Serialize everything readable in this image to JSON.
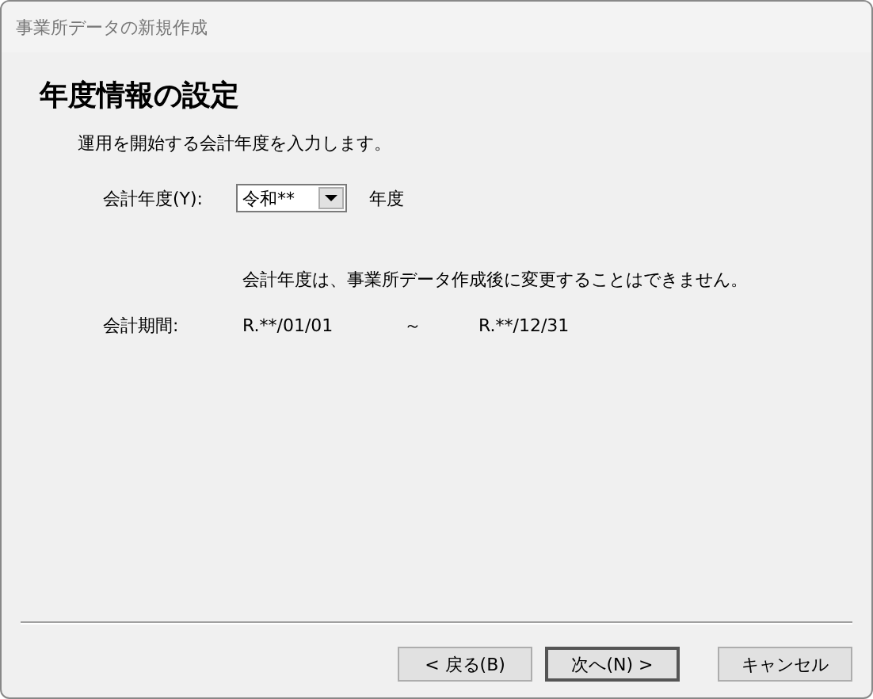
{
  "window": {
    "title": "事業所データの新規作成"
  },
  "heading": "年度情報の設定",
  "instruction": "運用を開始する会計年度を入力します。",
  "fiscal_year": {
    "label": "会計年度(Y):",
    "value": "令和**",
    "suffix": "年度"
  },
  "note": "会計年度は、事業所データ作成後に変更することはできません。",
  "period": {
    "label": "会計期間:",
    "start": "R.**/01/01",
    "separator": "～",
    "end": "R.**/12/31"
  },
  "buttons": [
    {
      "label": "< 戻る(B)",
      "default": false
    },
    {
      "label": "次へ(N) >",
      "default": true
    },
    {
      "label": "キャンセル",
      "default": false
    }
  ]
}
